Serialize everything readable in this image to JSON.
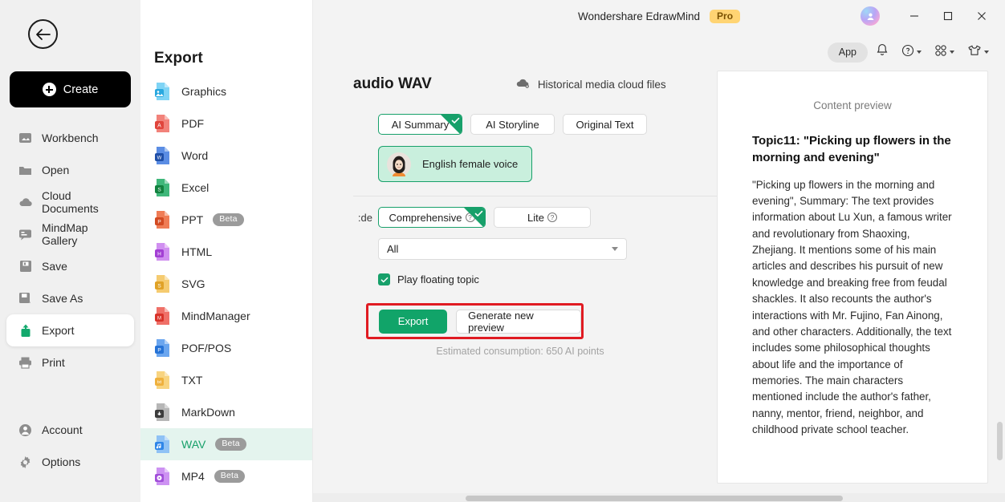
{
  "window": {
    "title": "Wondershare EdrawMind",
    "pro_badge": "Pro",
    "minimize": "–",
    "maximize": "□",
    "close": "✕"
  },
  "toolbar": {
    "app_pill": "App",
    "bell_icon": "bell-icon",
    "help_icon": "help-circle-icon",
    "grid_icon": "grid-apps-icon",
    "theme_icon": "shirt-theme-icon"
  },
  "leftnav": {
    "back_icon": "back-arrow-icon",
    "create_label": "Create",
    "items": [
      {
        "label": "Workbench",
        "icon": "workbench-icon",
        "active": false
      },
      {
        "label": "Open",
        "icon": "folder-icon",
        "active": false
      },
      {
        "label": "Cloud Documents",
        "icon": "cloud-icon",
        "active": false
      },
      {
        "label": "MindMap Gallery",
        "icon": "gallery-icon",
        "active": false
      },
      {
        "label": "Save",
        "icon": "save-icon",
        "active": false
      },
      {
        "label": "Save As",
        "icon": "save-as-icon",
        "active": false
      },
      {
        "label": "Export",
        "icon": "export-icon",
        "active": true
      },
      {
        "label": "Print",
        "icon": "printer-icon",
        "active": false
      }
    ],
    "bottom_items": [
      {
        "label": "Account",
        "icon": "account-icon"
      },
      {
        "label": "Options",
        "icon": "gear-icon"
      }
    ]
  },
  "export_panel": {
    "heading": "Export",
    "selected": "WAV",
    "items": [
      {
        "label": "Graphics",
        "badge": "",
        "color": "#5ec8ef",
        "letter": ""
      },
      {
        "label": "PDF",
        "badge": "",
        "color": "#f2685f",
        "letter": "A"
      },
      {
        "label": "Word",
        "badge": "",
        "color": "#2b62c4",
        "letter": "W"
      },
      {
        "label": "Excel",
        "badge": "",
        "color": "#1e9e58",
        "letter": "S"
      },
      {
        "label": "PPT",
        "badge": "Beta",
        "color": "#e1522c",
        "letter": "P"
      },
      {
        "label": "HTML",
        "badge": "",
        "color": "#c05ae0",
        "letter": "H"
      },
      {
        "label": "SVG",
        "badge": "",
        "color": "#f0b53e",
        "letter": "S"
      },
      {
        "label": "MindManager",
        "badge": "",
        "color": "#e03a33",
        "letter": "M"
      },
      {
        "label": "POF/POS",
        "badge": "",
        "color": "#2b7fe0",
        "letter": "P"
      },
      {
        "label": "TXT",
        "badge": "",
        "color": "#f7c34f",
        "letter": "txt"
      },
      {
        "label": "MarkDown",
        "badge": "",
        "color": "#4a4a4a",
        "letter": "↓"
      },
      {
        "label": "WAV",
        "badge": "Beta",
        "color": "#2f86e8",
        "letter": "♫"
      },
      {
        "label": "MP4",
        "badge": "Beta",
        "color": "#b85ce0",
        "letter": "▶"
      }
    ]
  },
  "main": {
    "doc_title": "audio WAV",
    "cloud_link": "Historical media cloud files",
    "cloud_icon": "cloud-icon",
    "content_tabs": [
      {
        "label": "AI Summary",
        "selected": true
      },
      {
        "label": "AI Storyline",
        "selected": false
      },
      {
        "label": "Original Text",
        "selected": false
      }
    ],
    "voice": {
      "label": "English female voice",
      "avatar_icon": "female-avatar-icon"
    },
    "mode_label": "de:",
    "mode_options": [
      {
        "label": "Comprehensive",
        "selected": true,
        "help": "?"
      },
      {
        "label": "Lite",
        "selected": false,
        "help": "?"
      }
    ],
    "scope_select": {
      "value": "All",
      "caret_icon": "chevron-down-icon"
    },
    "checkbox": {
      "label": "Play floating topic",
      "checked": true
    },
    "export_button": "Export",
    "generate_button": "Generate new preview",
    "estimate": "Estimated consumption: 650 AI points"
  },
  "preview": {
    "header": "Content preview",
    "topic": "Topic11: \"Picking up flowers in the morning and evening\"",
    "body": "\"Picking up flowers in the morning and evening\", Summary: The text provides information about Lu Xun, a famous writer and revolutionary from Shaoxing, Zhejiang. It mentions some of his main articles and describes his pursuit of new knowledge and breaking free from feudal shackles. It also recounts the author's interactions with Mr. Fujino, Fan Ainong, and other characters. Additionally, the text includes some philosophical thoughts about life and the importance of memories. The main characters mentioned include the author's father, nanny, mentor, friend, neighbor, and childhood private school teacher."
  },
  "colors": {
    "accent_green": "#17a06a",
    "export_button_green": "#11a469",
    "highlight_red": "#e01b22",
    "pro_yellow": "#ffd473",
    "selected_row": "#e4f4ee"
  }
}
